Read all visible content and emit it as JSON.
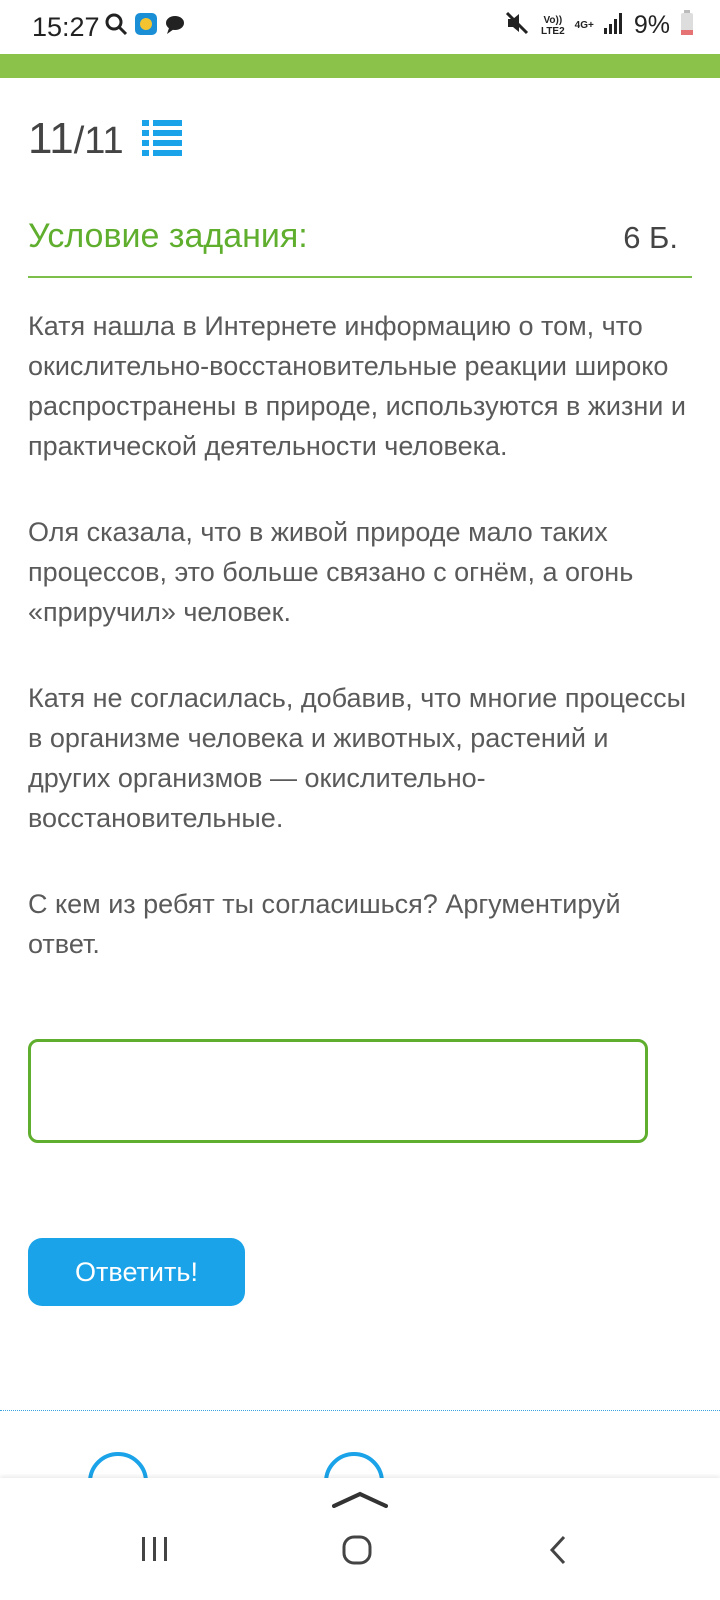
{
  "status_bar": {
    "time": "15:27",
    "network_top": "Vo))",
    "network_bottom": "LTE2",
    "network_gen": "4G+",
    "battery": "9%",
    "icons": [
      "search-icon",
      "app-icon",
      "chat-icon",
      "mute-icon",
      "signal-icon",
      "battery-icon"
    ]
  },
  "header": {
    "counter_current": "11",
    "counter_total": "/11",
    "list_icon": "list-icon"
  },
  "task": {
    "title": "Условие задания:",
    "points": "6 Б.",
    "paragraphs": [
      "Катя нашла в Интернете информацию о том, что окислительно-восстановительные реакции широко распространены в природе, используются в жизни и практической деятельности человека.",
      "Оля сказала, что в живой природе мало таких процессов, это больше связано с огнём, а огонь «приручил» человек.",
      "Катя не согласилась, добавив, что многие процессы в организме человека и животных, растений и других организмов — окислительно-восстановительные.",
      "С кем из ребят ты согласишься?  Аргументируй ответ."
    ]
  },
  "answer": {
    "value": "",
    "submit_label": "Ответить!"
  },
  "colors": {
    "accent_green": "#5fae2e",
    "bar_green": "#8bc34a",
    "button_blue": "#1aa3e8"
  },
  "navigation": {
    "icons": [
      "recent-apps-icon",
      "home-icon",
      "back-icon"
    ]
  }
}
